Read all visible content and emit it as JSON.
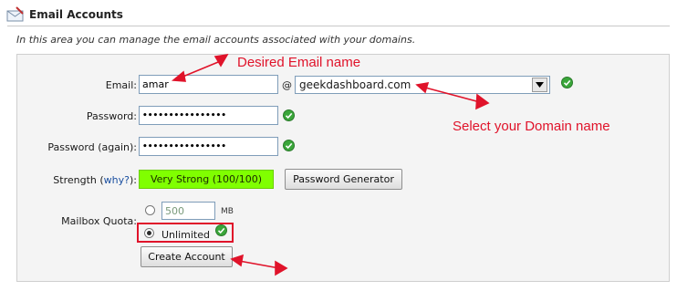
{
  "header": {
    "title": "Email Accounts",
    "icon": "envelope-icon",
    "intro": "In this area you can manage the email accounts associated with your domains."
  },
  "form": {
    "email_label": "Email:",
    "email_value": "amar",
    "at_sign": "@",
    "domain_value": "geekdashboard.com",
    "password_label": "Password:",
    "password_value": "••••••••••••••••",
    "password_again_label": "Password (again):",
    "password_again_value": "••••••••••••••••",
    "strength_label": "Strength (",
    "strength_why": "why?",
    "strength_label_end": "):",
    "strength_value": "Very Strong (100/100)",
    "password_generator_label": "Password Generator",
    "quota_label": "Mailbox Quota:",
    "quota_value": "500",
    "quota_unit": "MB",
    "unlimited_label": "Unlimited",
    "quota_mode": "unlimited",
    "create_label": "Create Account"
  },
  "annotations": {
    "desired_email": "Desired Email name",
    "select_domain": "Select your Domain name"
  },
  "colors": {
    "annotation": "#e0132a",
    "strength": "#80ff00",
    "check": "#3aa63a"
  }
}
